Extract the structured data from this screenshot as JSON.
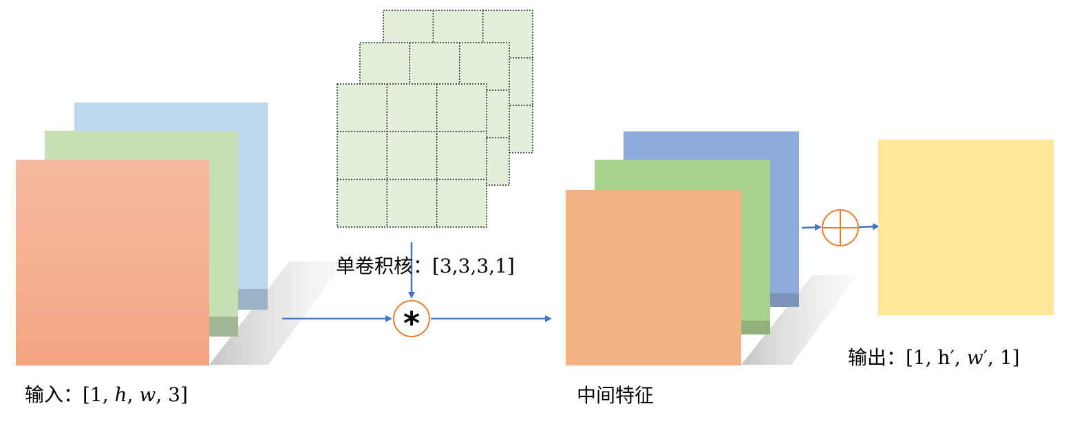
{
  "labels": {
    "input": "输入：[1, ℎ, 𝑤, 3]",
    "kernel": "单卷积核：[3,3,3,1]",
    "intermediate": "中间特征",
    "output": "输出：[1, h′, 𝑤′, 1]"
  },
  "operators": {
    "convolution": "*",
    "sum": "⊕"
  },
  "colors": {
    "input_channels": [
      "#f4a582",
      "#c5e0b4",
      "#bdd7ee"
    ],
    "kernel_fill": "#e2efda",
    "feature_channels": [
      "#f4b183",
      "#a9d18e",
      "#8faadc"
    ],
    "output_fill": "#ffe699",
    "arrow": "#4472c4",
    "operator_ring": "#ed7d31"
  },
  "kernel": {
    "rows": 3,
    "cols": 3,
    "depth": 3
  }
}
